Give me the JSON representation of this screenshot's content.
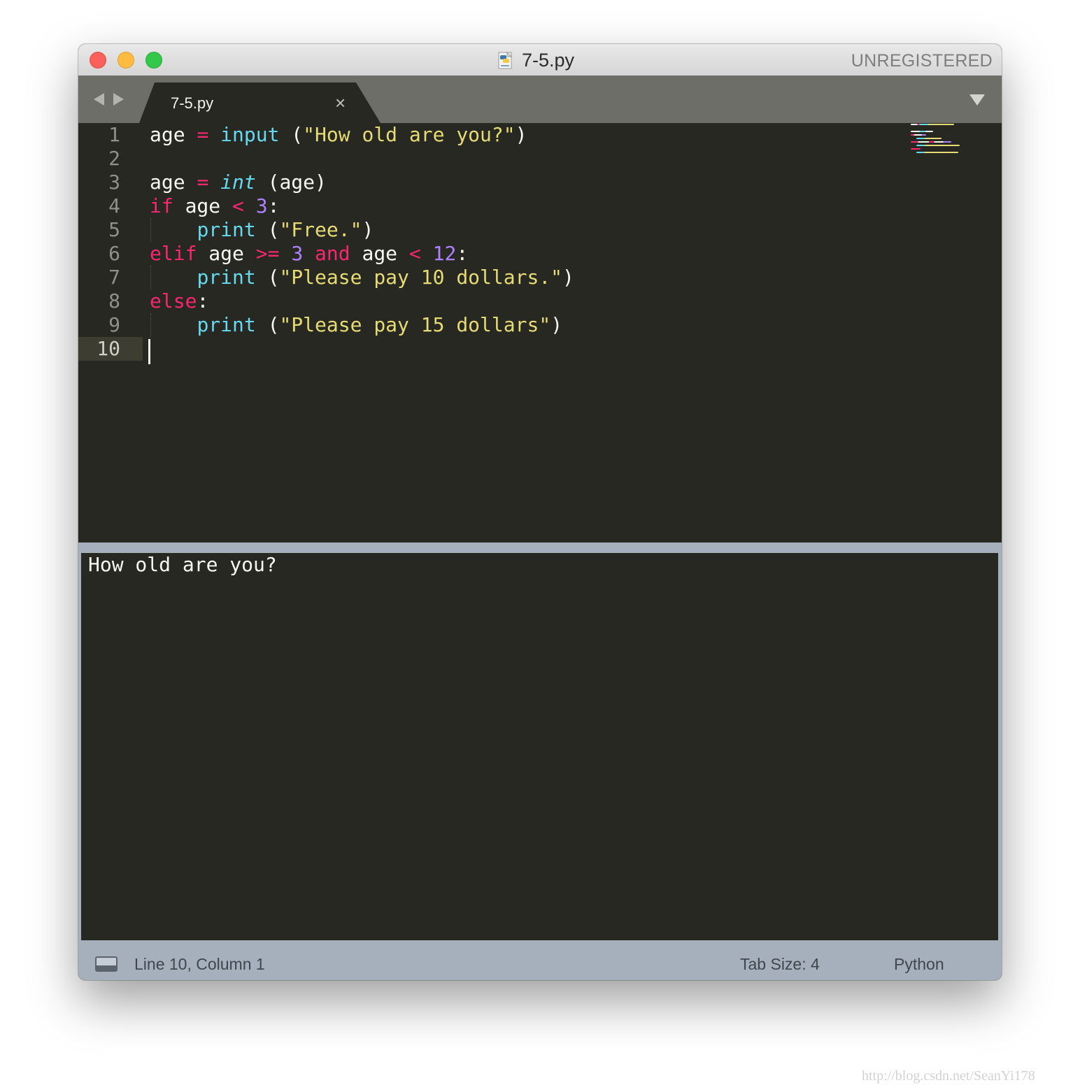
{
  "window": {
    "title": "7-5.py",
    "license_label": "UNREGISTERED",
    "title_file_icon": "python-file-icon",
    "traffic_lights": {
      "close_color": "#fc605b",
      "minimize_color": "#fdbc40",
      "maximize_color": "#34c84a"
    }
  },
  "tabs": [
    {
      "label": "7-5.py",
      "active": true,
      "close_glyph": "×"
    }
  ],
  "editor": {
    "theme_colors": {
      "background": "#272822",
      "keyword": "#f92672",
      "function": "#66d9ef",
      "string": "#e6db74",
      "number": "#ae81ff",
      "text": "#f8f8f2"
    },
    "current_line": 10,
    "lines": [
      {
        "number": "1",
        "tokens": [
          {
            "t": "age ",
            "c": "tx"
          },
          {
            "t": "=",
            "c": "kw"
          },
          {
            "t": " ",
            "c": "tx"
          },
          {
            "t": "input",
            "c": "fn"
          },
          {
            "t": " (",
            "c": "tx"
          },
          {
            "t": "\"How old are you?\"",
            "c": "st"
          },
          {
            "t": ")",
            "c": "tx"
          }
        ]
      },
      {
        "number": "2",
        "tokens": []
      },
      {
        "number": "3",
        "tokens": [
          {
            "t": "age ",
            "c": "tx"
          },
          {
            "t": "=",
            "c": "kw"
          },
          {
            "t": " ",
            "c": "tx"
          },
          {
            "t": "int",
            "c": "it"
          },
          {
            "t": " (age)",
            "c": "tx"
          }
        ]
      },
      {
        "number": "4",
        "tokens": [
          {
            "t": "if",
            "c": "kw"
          },
          {
            "t": " age ",
            "c": "tx"
          },
          {
            "t": "<",
            "c": "kw"
          },
          {
            "t": " ",
            "c": "tx"
          },
          {
            "t": "3",
            "c": "nm"
          },
          {
            "t": ":",
            "c": "tx"
          }
        ]
      },
      {
        "number": "5",
        "tokens": [
          {
            "t": "    ",
            "c": "tx"
          },
          {
            "t": "print",
            "c": "fn"
          },
          {
            "t": " (",
            "c": "tx"
          },
          {
            "t": "\"Free.\"",
            "c": "st"
          },
          {
            "t": ")",
            "c": "tx"
          }
        ]
      },
      {
        "number": "6",
        "tokens": [
          {
            "t": "elif",
            "c": "kw"
          },
          {
            "t": " age ",
            "c": "tx"
          },
          {
            "t": ">=",
            "c": "kw"
          },
          {
            "t": " ",
            "c": "tx"
          },
          {
            "t": "3",
            "c": "nm"
          },
          {
            "t": " ",
            "c": "tx"
          },
          {
            "t": "and",
            "c": "kw"
          },
          {
            "t": " age ",
            "c": "tx"
          },
          {
            "t": "<",
            "c": "kw"
          },
          {
            "t": " ",
            "c": "tx"
          },
          {
            "t": "12",
            "c": "nm"
          },
          {
            "t": ":",
            "c": "tx"
          }
        ]
      },
      {
        "number": "7",
        "tokens": [
          {
            "t": "    ",
            "c": "tx"
          },
          {
            "t": "print",
            "c": "fn"
          },
          {
            "t": " (",
            "c": "tx"
          },
          {
            "t": "\"Please pay 10 dollars.\"",
            "c": "st"
          },
          {
            "t": ")",
            "c": "tx"
          }
        ]
      },
      {
        "number": "8",
        "tokens": [
          {
            "t": "else",
            "c": "kw"
          },
          {
            "t": ":",
            "c": "tx"
          }
        ]
      },
      {
        "number": "9",
        "tokens": [
          {
            "t": "    ",
            "c": "tx"
          },
          {
            "t": "print",
            "c": "fn"
          },
          {
            "t": " (",
            "c": "tx"
          },
          {
            "t": "\"Please pay 15 dollars\"",
            "c": "st"
          },
          {
            "t": ")",
            "c": "tx"
          }
        ]
      },
      {
        "number": "10",
        "tokens": []
      }
    ]
  },
  "output_panel": {
    "text": "How old are you?"
  },
  "status_bar": {
    "panel_toggle_icon": "panel-toggle-icon",
    "position": "Line 10, Column 1",
    "tab_size": "Tab Size: 4",
    "syntax": "Python",
    "background": "#a6b0bc"
  },
  "watermark": "http://blog.csdn.net/SeanYi178"
}
